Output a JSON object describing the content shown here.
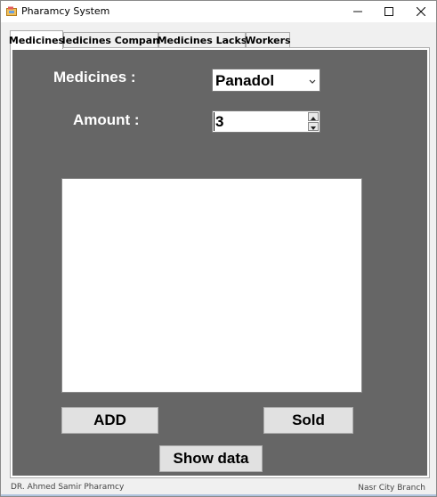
{
  "window": {
    "title": "Pharamcy System",
    "controls": {
      "minimize": "—",
      "maximize": "☐",
      "close": "✕"
    }
  },
  "tabs": [
    {
      "label": "Medicines",
      "active": true
    },
    {
      "label": "Medicines Company",
      "active": false
    },
    {
      "label": "Medicines Lacks",
      "active": false
    },
    {
      "label": "Workers",
      "active": false
    }
  ],
  "form": {
    "medicines_label": "Medicines :",
    "medicines_selected": "Panadol",
    "amount_label": "Amount :",
    "amount_value": "3"
  },
  "buttons": {
    "add": "ADD",
    "sold": "Sold",
    "show_data": "Show data"
  },
  "status": {
    "left": "DR. Ahmed Samir Pharamcy",
    "right": "Nasr City Branch"
  },
  "colors": {
    "panel_bg": "#666666",
    "window_bg": "#f0f0f0",
    "button_bg": "#e1e1e1"
  },
  "icons": {
    "app": "pharmacy-app-icon",
    "dropdown": "chevron-down-icon",
    "spin_up": "spin-up-icon",
    "spin_down": "spin-down-icon"
  }
}
